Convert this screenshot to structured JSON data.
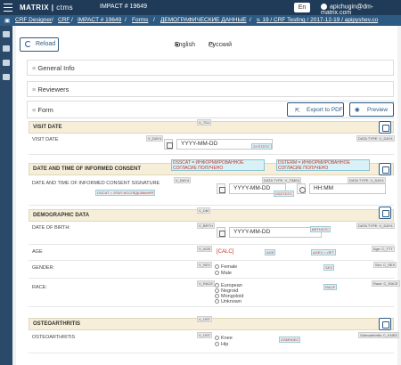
{
  "topbar": {
    "brand": "MATRIX",
    "brand_suffix": "ctms",
    "impact": "IMPACT # 19649",
    "lang": "En",
    "user": "apichugin@dm-matrix.com"
  },
  "breadcrumbs": [
    "CRF Designer",
    "CRF",
    "IMPACT # 19649",
    "Forms",
    "ДЕМОГРАФИЧЕСКИЕ ДАННЫЕ",
    "v. 19 / CRF Testing / 2017-12-19 / apipyshev.co"
  ],
  "toolbar": {
    "reload": "Reload",
    "lang_en": "English",
    "lang_ru": "Русский"
  },
  "panels": {
    "general_info": "General Info",
    "reviewers": "Reviewers",
    "form": "Form",
    "export_pdf": "Export to PDF",
    "preview": "Preview"
  },
  "visit_date": {
    "title": "VISIT DATE",
    "code": "V_TD1",
    "label": "VISIT DATE",
    "label_code": "V_DAY4",
    "value": "YYYY-MM-DD",
    "var_chip": "SYSTDTC",
    "right_chip": "DATA TYPE: V_DAY4"
  },
  "consent": {
    "title": "DATE AND TIME OF INFORMED CONSENT",
    "chip1": "DSSCAT = ИНФОРМИРОВАННОЕ СОГЛАСИЕ ПОЛУЧЕНО",
    "chip2": "DSTERM = ИНФОРМИРОВАННОЕ СОГЛАСИЕ ПОЛУЧЕНО",
    "label": "DATE AND TIME OF INFORMED CONSENT SIGNATURE",
    "label_chip": "DSCAT = ЭТАП ИССЛЕДОВАНИЯ",
    "label_code": "V_DAY4",
    "date_value": "YYYY-MM-DD",
    "time_value": "HH:MM",
    "var_chip": "DSSTDTC",
    "type_chip1": "DATA TYPE: V_TIME4",
    "type_chip2": "DATA TYPE: V_DAY4"
  },
  "demographic": {
    "title": "DEMOGRAPHIC DATA",
    "code": "V_DM",
    "dob_label": "DATE OF BIRTH:",
    "dob_code": "V_BRTH",
    "dob_value": "YYYY-MM-DD",
    "dob_var": "BRTHDTC",
    "dob_type": "DATA TYPE: V_DAY4",
    "age_label": "AGE",
    "age_code": "V_AGE",
    "age_calc": "[CALC]",
    "age_var": "AGE",
    "ageu_var": "AGEU = ЛЕТ",
    "age_type": "Age: C_TTT",
    "gender_label": "GENDER:",
    "gender_code": "V_SEX",
    "gender_opts": [
      "Female",
      "Male"
    ],
    "gender_var": "SEX",
    "gender_type": "Sex: C_SEX",
    "race_label": "RACE:",
    "race_code": "V_RACE",
    "race_opts": [
      "European",
      "Negroid",
      "Mongoloid",
      "Unknown"
    ],
    "race_var": "RACE",
    "race_type": "Race: C_RACE"
  },
  "osteo": {
    "title": "OSTEOARTHRITIS",
    "code": "V_OST",
    "label": "OSTEOARTHRITIS",
    "label_code": "V_OST",
    "opts": [
      "Knee",
      "Hip"
    ],
    "var": "OSMHDEC",
    "type": "Osteoarthritis: C_KNEE"
  }
}
